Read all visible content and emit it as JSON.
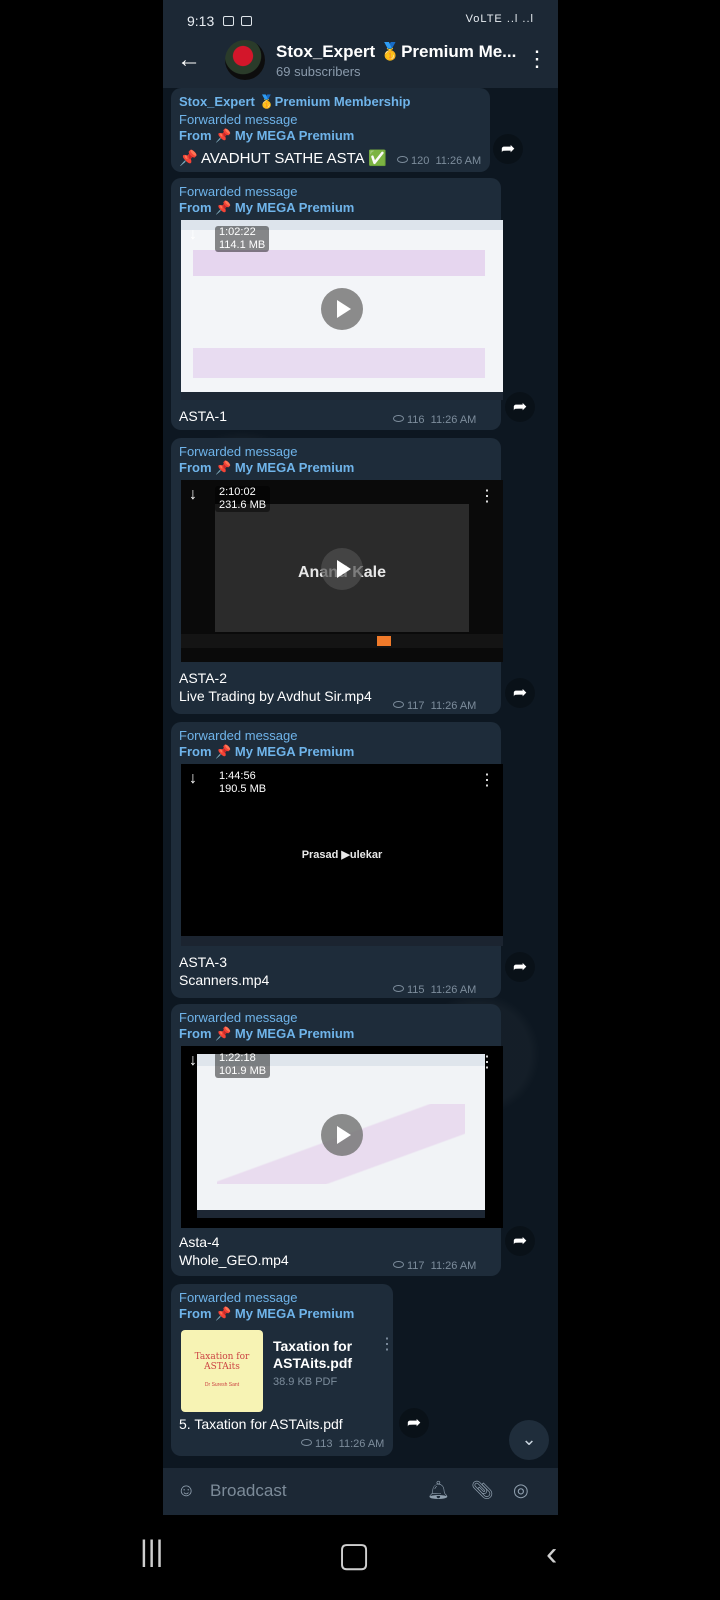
{
  "status_bar": {
    "time": "9:13",
    "signal": "VoLTE ..l ..l"
  },
  "header": {
    "back_icon": "arrow-left-icon",
    "title": "Stox_Expert 🥇Premium Me...",
    "subtitle": "69 subscribers",
    "menu_icon": "more-vert-icon"
  },
  "messages": [
    {
      "sender": "Stox_Expert 🥇Premium Membership",
      "forwarded": "Forwarded message",
      "from": "From 📌 My MEGA Premium",
      "text": "📌 AVADHUT SATHE ASTA ✅",
      "views": "120",
      "time": "11:26 AM"
    },
    {
      "forwarded": "Forwarded message",
      "from": "From 📌 My MEGA Premium",
      "duration": "1:02:22",
      "size": "114.1 MB",
      "caption": "ASTA-1",
      "views": "116",
      "time": "11:26 AM"
    },
    {
      "forwarded": "Forwarded message",
      "from": "From 📌 My MEGA Premium",
      "duration": "2:10:02",
      "size": "231.6 MB",
      "overlay": "Anand Kale",
      "caption": "ASTA-2",
      "caption2": "Live Trading by Avdhut Sir.mp4",
      "views": "117",
      "time": "11:26 AM"
    },
    {
      "forwarded": "Forwarded message",
      "from": "From 📌 My MEGA Premium",
      "duration": "1:44:56",
      "size": "190.5 MB",
      "overlay": "Prasad ▶ulekar",
      "caption": "ASTA-3",
      "caption2": "Scanners.mp4",
      "views": "115",
      "time": "11:26 AM"
    },
    {
      "forwarded": "Forwarded message",
      "from": "From 📌 My MEGA Premium",
      "duration": "1:22:18",
      "size": "101.9 MB",
      "caption": "Asta-4",
      "caption2": "Whole_GEO.mp4",
      "views": "117",
      "time": "11:26 AM"
    },
    {
      "forwarded": "Forwarded message",
      "from": "From 📌 My MEGA Premium",
      "thumb_title": "Taxation for ASTAits",
      "thumb_sub": "Dr Suresh Sant",
      "file_name": "Taxation for ASTAits.pdf",
      "file_size": "38.9 KB PDF",
      "caption": "5. Taxation for ASTAits.pdf",
      "views": "113",
      "time": "11:26 AM"
    }
  ],
  "composer": {
    "placeholder": "Broadcast"
  },
  "colors": {
    "accent": "#6fb4ea",
    "bubble": "#1e2c3a",
    "background": "#0d1721"
  }
}
